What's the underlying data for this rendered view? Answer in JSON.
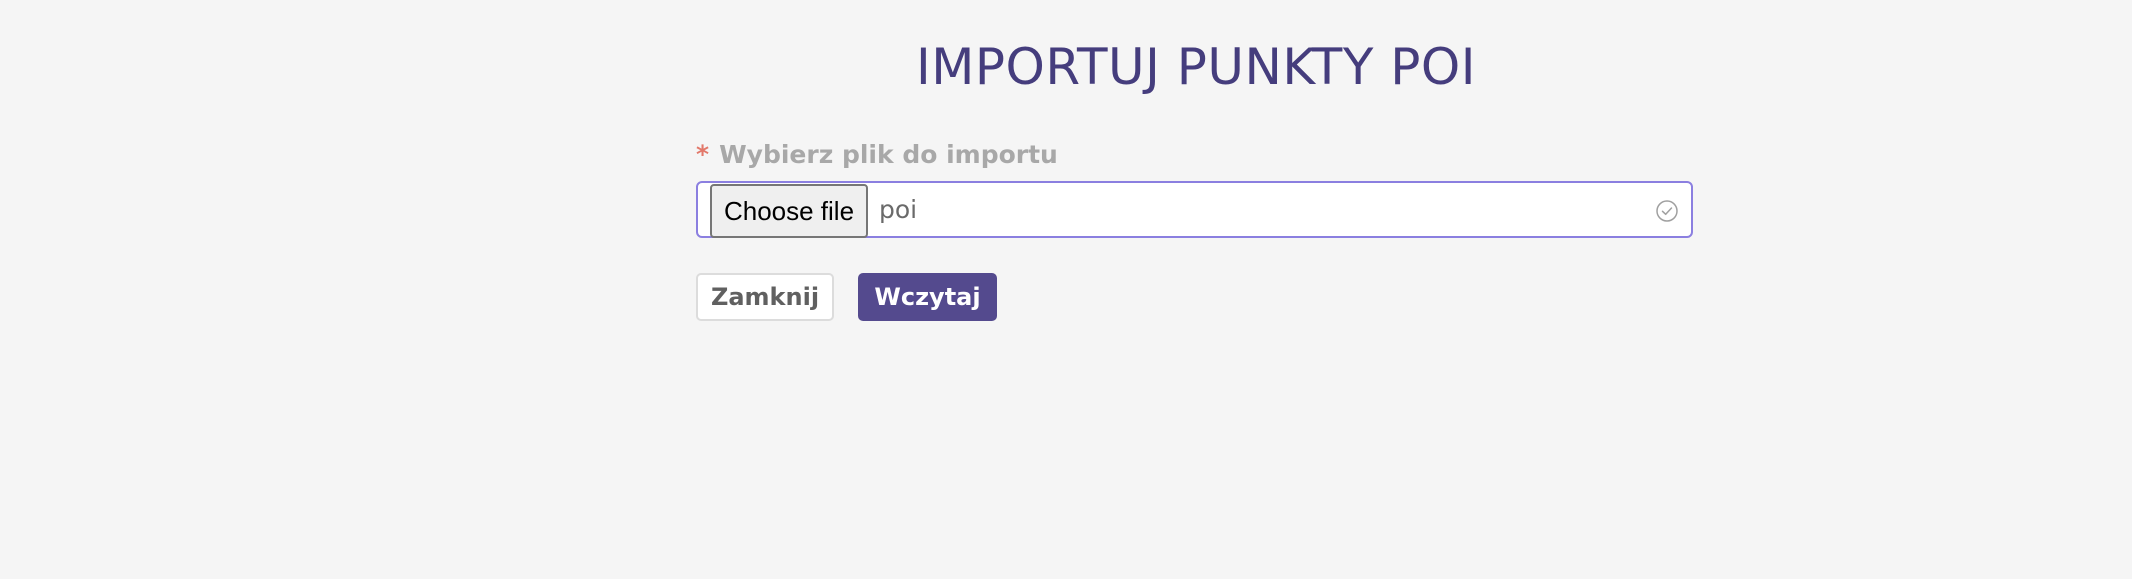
{
  "page": {
    "title": "IMPORTUJ PUNKTY POI"
  },
  "form": {
    "required_mark": "*",
    "file_label": "Wybierz plik do importu",
    "choose_file_label": "Choose file",
    "selected_file_name": "poi",
    "status_icon": "check-circle-icon"
  },
  "actions": {
    "close_label": "Zamknij",
    "load_label": "Wczytaj"
  },
  "colors": {
    "title": "#453d7d",
    "primary": "#544a8e",
    "focus_border": "#8b7fe0",
    "required": "#e2786a",
    "label": "#a8a8a8",
    "background": "#f5f5f5"
  }
}
